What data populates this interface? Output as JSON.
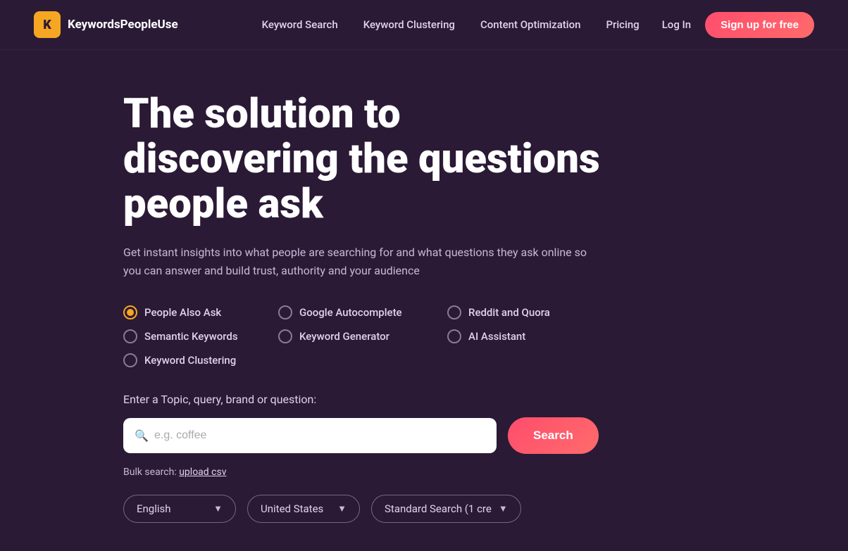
{
  "brand": {
    "logo_letter": "K",
    "name": "KeywordsPeopleUse"
  },
  "nav": {
    "links": [
      {
        "label": "Keyword Search",
        "id": "keyword-search"
      },
      {
        "label": "Keyword Clustering",
        "id": "keyword-clustering"
      },
      {
        "label": "Content Optimization",
        "id": "content-optimization"
      },
      {
        "label": "Pricing",
        "id": "pricing"
      }
    ],
    "login_label": "Log In",
    "signup_label": "Sign up for free"
  },
  "hero": {
    "title": "The solution to discovering the questions people ask",
    "subtitle": "Get instant insights into what people are searching for and what questions they ask online so you can answer and build trust, authority and your audience"
  },
  "radio_options": [
    {
      "id": "people-also-ask",
      "label": "People Also Ask",
      "active": true
    },
    {
      "id": "google-autocomplete",
      "label": "Google Autocomplete",
      "active": false
    },
    {
      "id": "reddit-and-quora",
      "label": "Reddit and Quora",
      "active": false
    },
    {
      "id": "semantic-keywords",
      "label": "Semantic Keywords",
      "active": false
    },
    {
      "id": "keyword-generator",
      "label": "Keyword Generator",
      "active": false
    },
    {
      "id": "ai-assistant",
      "label": "AI Assistant",
      "active": false
    },
    {
      "id": "keyword-clustering-option",
      "label": "Keyword Clustering",
      "active": false
    }
  ],
  "search": {
    "label": "Enter a Topic, query, brand or question:",
    "placeholder": "e.g. coffee",
    "button_label": "Search"
  },
  "bulk": {
    "text": "Bulk search:",
    "link_label": "upload csv"
  },
  "dropdowns": [
    {
      "id": "language",
      "label": "English"
    },
    {
      "id": "country",
      "label": "United States"
    },
    {
      "id": "search-type",
      "label": "Standard Search (1 cre"
    }
  ],
  "colors": {
    "accent_orange": "#f5a623",
    "accent_pink": "#ff4d6d",
    "bg": "#2a1a35"
  }
}
